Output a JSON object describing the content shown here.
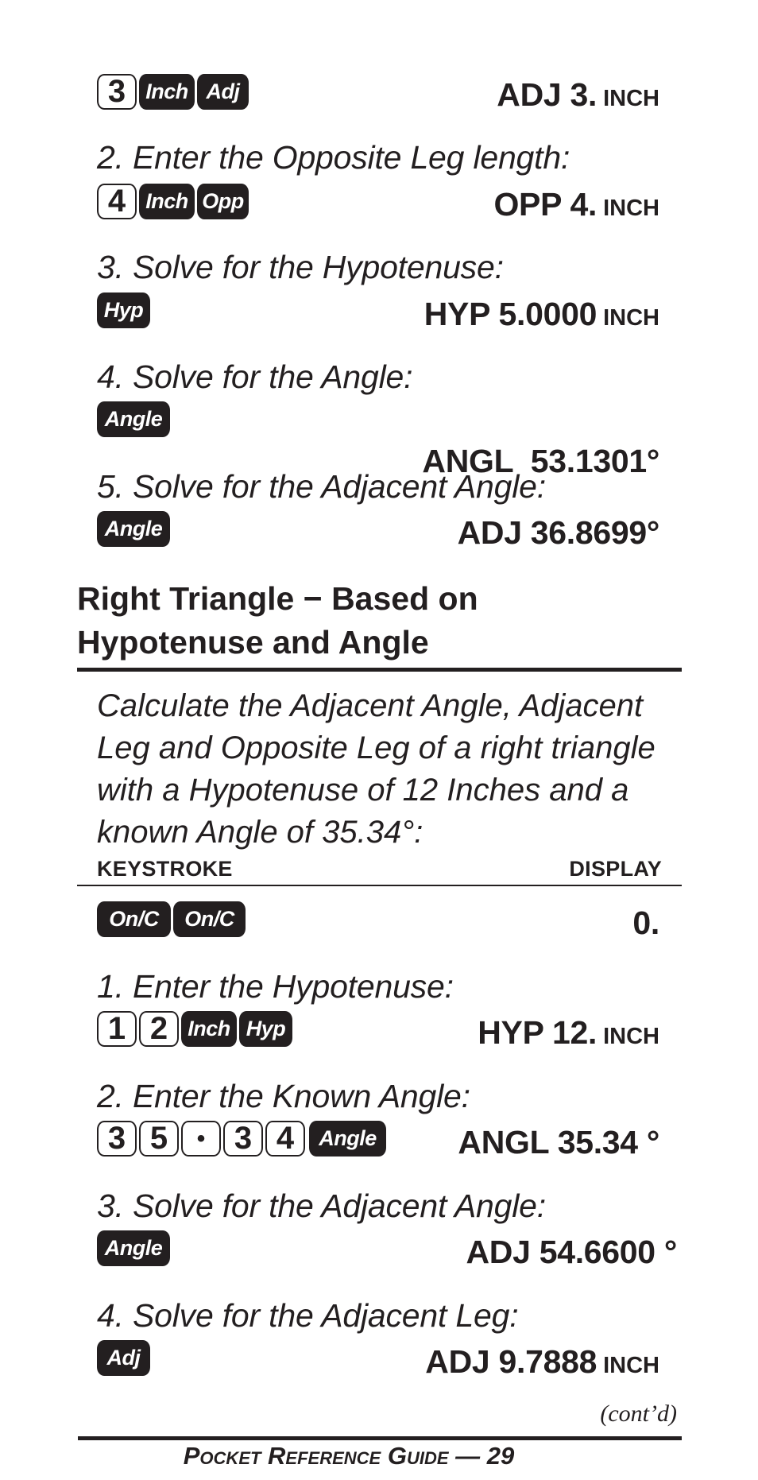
{
  "section_top": {
    "rows": [
      {
        "step": null,
        "keys": [
          {
            "label": "3",
            "style": "light"
          },
          {
            "label": "Inch",
            "style": "dark"
          },
          {
            "label": "Adj",
            "style": "dark"
          }
        ],
        "display": {
          "value": "ADJ 3.",
          "unit": "INCH"
        }
      },
      {
        "step": "2. Enter the Opposite Leg length:",
        "keys": [
          {
            "label": "4",
            "style": "light"
          },
          {
            "label": "Inch",
            "style": "dark"
          },
          {
            "label": "Opp",
            "style": "dark"
          }
        ],
        "display": {
          "value": "OPP 4.",
          "unit": "INCH"
        }
      },
      {
        "step": "3. Solve for the Hypotenuse:",
        "keys": [
          {
            "label": "Hyp",
            "style": "dark"
          }
        ],
        "display": {
          "value": "HYP 5.0000",
          "unit": "INCH"
        }
      },
      {
        "step": "4. Solve for the Angle:",
        "keys": [
          {
            "label": "Angle",
            "style": "dark"
          }
        ],
        "display": {
          "value": "ANGL  53.1301°",
          "unit": ""
        }
      },
      {
        "step": "5. Solve for the Adjacent Angle:",
        "keys": [
          {
            "label": "Angle",
            "style": "dark"
          }
        ],
        "display": {
          "value": "ADJ 36.8699°",
          "unit": ""
        }
      }
    ]
  },
  "section_heading": {
    "line1": "Right Triangle − Based on",
    "line2": "Hypotenuse and Angle"
  },
  "description": {
    "lines": [
      "Calculate the Adjacent Angle, Adjacent",
      "Leg and Opposite Leg of a right triangle",
      "with a Hypotenuse of 12 Inches and a",
      "known Angle of 35.34°:"
    ]
  },
  "table_header": {
    "keystroke": "KEYSTROKE",
    "display": "DISPLAY"
  },
  "section_bottom": {
    "rows": [
      {
        "step": null,
        "keys": [
          {
            "label": "On/C",
            "style": "dark"
          },
          {
            "label": "On/C",
            "style": "dark"
          }
        ],
        "display": {
          "value": "0.",
          "unit": ""
        }
      },
      {
        "step": "1. Enter the Hypotenuse:",
        "keys": [
          {
            "label": "1",
            "style": "light"
          },
          {
            "label": "2",
            "style": "light"
          },
          {
            "label": "Inch",
            "style": "dark"
          },
          {
            "label": "Hyp",
            "style": "dark"
          }
        ],
        "display": {
          "value": "HYP 12.",
          "unit": "INCH"
        }
      },
      {
        "step": "2. Enter the Known Angle:",
        "keys": [
          {
            "label": "3",
            "style": "light"
          },
          {
            "label": "5",
            "style": "light"
          },
          {
            "label": "•",
            "style": "light"
          },
          {
            "label": "3",
            "style": "light"
          },
          {
            "label": "4",
            "style": "light"
          },
          {
            "label": "Angle",
            "style": "dark"
          }
        ],
        "display": {
          "value": "ANGL 35.34 °",
          "unit": ""
        }
      },
      {
        "step": "3. Solve for the Adjacent Angle:",
        "keys": [
          {
            "label": "Angle",
            "style": "dark"
          }
        ],
        "display": {
          "value": "ADJ 54.6600 °",
          "unit": ""
        }
      },
      {
        "step": "4. Solve for the Adjacent Leg:",
        "keys": [
          {
            "label": "Adj",
            "style": "dark"
          }
        ],
        "display": {
          "value": "ADJ 9.7888",
          "unit": "INCH"
        }
      }
    ]
  },
  "continued_label": "(cont’d)",
  "footer": {
    "title": "Pocket Reference Guide",
    "separator": "—",
    "page_number": "29"
  }
}
